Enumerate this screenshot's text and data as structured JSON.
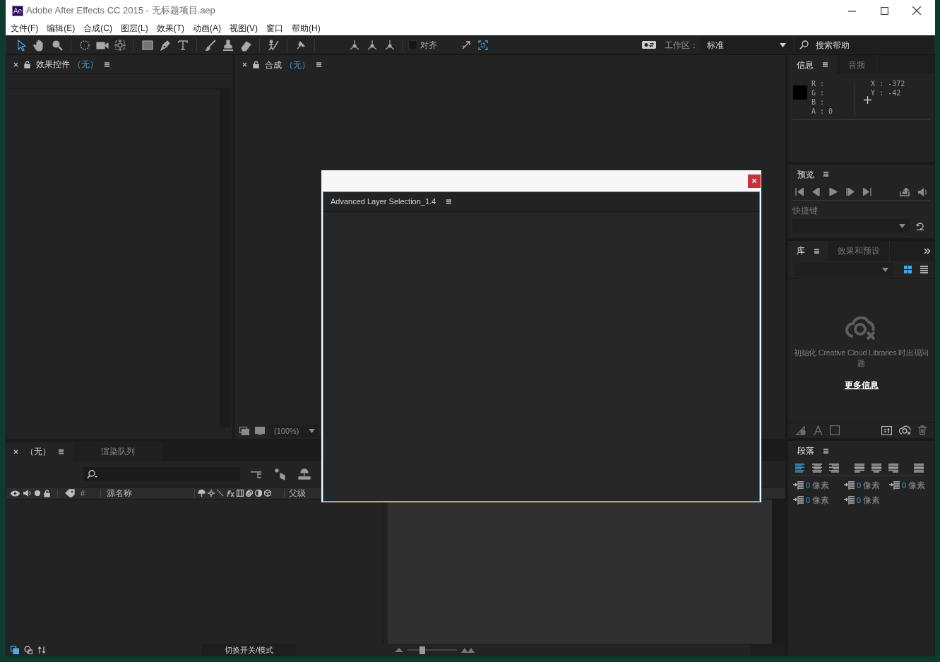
{
  "window": {
    "logo_text": "Ae",
    "title": "Adobe After Effects CC 2015 - 无标题项目.aep"
  },
  "menu": [
    "文件(F)",
    "编辑(E)",
    "合成(C)",
    "图层(L)",
    "效果(T)",
    "动画(A)",
    "视图(V)",
    "窗口",
    "帮助(H)"
  ],
  "toolbar": {
    "tools": [
      {
        "kind": "selection",
        "selected": true
      },
      {
        "kind": "hand",
        "selected": false
      },
      {
        "kind": "zoom",
        "selected": false
      },
      {
        "kind": "rotate",
        "selected": false
      },
      {
        "kind": "camera",
        "selected": false
      },
      {
        "kind": "pan",
        "selected": false
      },
      {
        "kind": "rectangle",
        "selected": false
      },
      {
        "kind": "pen",
        "selected": false
      },
      {
        "kind": "type",
        "selected": false
      },
      {
        "kind": "brush",
        "selected": false
      },
      {
        "kind": "stamp",
        "selected": false
      },
      {
        "kind": "eraser",
        "selected": false
      },
      {
        "kind": "roto",
        "selected": false
      },
      {
        "kind": "puppet",
        "selected": false
      },
      {
        "kind": "axis",
        "selected": false
      },
      {
        "kind": "axis",
        "selected": false
      },
      {
        "kind": "axis",
        "selected": false
      }
    ],
    "snap": {
      "label": "对齐",
      "checked": false
    },
    "workspace_label": "工作区：",
    "workspace_value": "标准",
    "search_placeholder": "搜索帮助"
  },
  "effect_controls": {
    "title": "效果控件",
    "target": "（无）"
  },
  "composition": {
    "title": "合成",
    "target": "（无）",
    "zoom": "(100%)"
  },
  "info": {
    "tabs": [
      {
        "label": "信息",
        "selected": true
      },
      {
        "label": "音频",
        "selected": false
      }
    ],
    "color_values": [
      "R :",
      "G :",
      "B :",
      "A : 0"
    ],
    "position": [
      "X : -372",
      "Y : -42"
    ]
  },
  "preview": {
    "title": "预览",
    "shortcut_label": "快捷键"
  },
  "library": {
    "tabs": [
      {
        "label": "库",
        "selected": true
      },
      {
        "label": "效果和预设",
        "selected": false
      }
    ],
    "message": "初始化 Creative Cloud Libraries 时出现问题",
    "link": "更多信息"
  },
  "paragraph": {
    "title": "段落",
    "fields": [
      {
        "value": "0",
        "unit": "像素"
      },
      {
        "value": "0",
        "unit": "像素"
      },
      {
        "value": "0",
        "unit": "像素"
      },
      {
        "value": "0",
        "unit": "像素"
      },
      {
        "value": "0",
        "unit": "像素"
      }
    ]
  },
  "timeline": {
    "tabs": [
      {
        "label": "（无）",
        "selected": true
      },
      {
        "label": "渲染队列",
        "selected": false
      }
    ],
    "columns": [
      "#",
      "源名称",
      "父级"
    ],
    "footer_toggle": "切换开关/模式",
    "zoom": {
      "level": 0.28
    }
  },
  "dialog": {
    "tab": "Advanced Layer Selection_1.4"
  }
}
